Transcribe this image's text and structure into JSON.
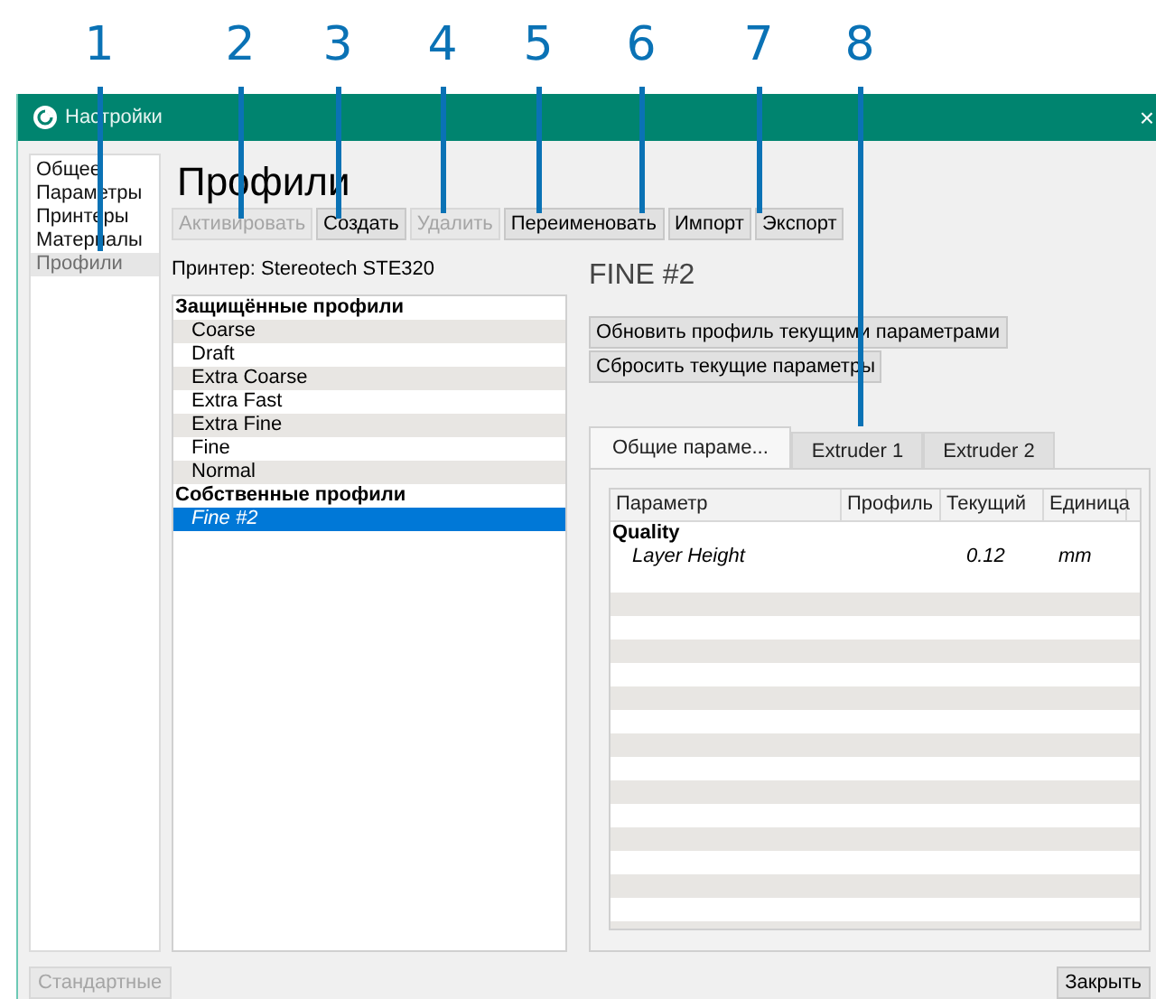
{
  "callouts": [
    {
      "label": "1"
    },
    {
      "label": "2"
    },
    {
      "label": "3"
    },
    {
      "label": "4"
    },
    {
      "label": "5"
    },
    {
      "label": "6"
    },
    {
      "label": "7"
    },
    {
      "label": "8"
    }
  ],
  "window": {
    "title": "Настройки",
    "close": "×"
  },
  "sidebar": {
    "items": [
      {
        "label": "Общее",
        "selected": false
      },
      {
        "label": "Параметры",
        "selected": false
      },
      {
        "label": "Принтеры",
        "selected": false
      },
      {
        "label": "Материалы",
        "selected": false
      },
      {
        "label": "Профили",
        "selected": true
      }
    ]
  },
  "heading": "Профили",
  "toolbar": [
    {
      "label": "Активировать",
      "disabled": true
    },
    {
      "label": "Создать",
      "disabled": false
    },
    {
      "label": "Удалить",
      "disabled": true
    },
    {
      "label": "Переименовать",
      "disabled": false
    },
    {
      "label": "Импорт",
      "disabled": false
    },
    {
      "label": "Экспорт",
      "disabled": false
    }
  ],
  "printer": "Принтер: Stereotech STE320",
  "profiles": [
    {
      "group": "Защищённые профили",
      "items": [
        {
          "label": "Coarse",
          "selected": false
        },
        {
          "label": "Draft",
          "selected": false
        },
        {
          "label": "Extra Coarse",
          "selected": false
        },
        {
          "label": "Extra Fast",
          "selected": false
        },
        {
          "label": "Extra Fine",
          "selected": false
        },
        {
          "label": "Fine",
          "selected": false
        },
        {
          "label": "Normal",
          "selected": false
        }
      ]
    },
    {
      "group": "Собственные профили",
      "items": [
        {
          "label": "Fine #2",
          "selected": true
        }
      ]
    }
  ],
  "profile_title": "FINE #2",
  "profile_buttons": [
    "Обновить профиль текущими параметрами",
    "Сбросить текущие параметры"
  ],
  "tabs": [
    {
      "label": "Общие параме...",
      "selected": true
    },
    {
      "label": "Extruder 1",
      "selected": false
    },
    {
      "label": "Extruder 2",
      "selected": false
    }
  ],
  "table": {
    "columns": [
      "Параметр",
      "Профиль",
      "Текущий",
      "Единица"
    ],
    "sections": [
      {
        "name": "Quality",
        "rows": [
          [
            "Layer Height",
            "",
            "0.12",
            "mm"
          ]
        ]
      }
    ]
  },
  "footer": {
    "defaults": {
      "label": "Стандартные",
      "disabled": true
    },
    "close": {
      "label": "Закрыть",
      "disabled": false
    }
  }
}
